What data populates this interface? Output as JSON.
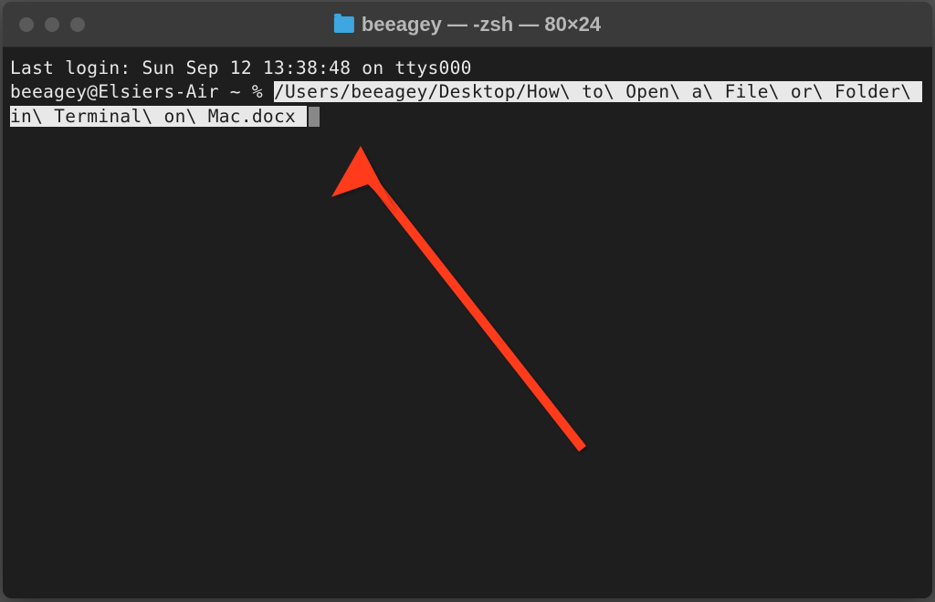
{
  "titlebar": {
    "title": "beeagey — -zsh — 80×24"
  },
  "terminal": {
    "last_login": "Last login: Sun Sep 12 13:38:48 on ttys000",
    "prompt": "beeagey@Elsiers-Air ~ % ",
    "command": "/Users/beeagey/Desktop/How\\ to\\ Open\\ a\\ File\\ or\\ Folder\\ in\\ Terminal\\ on\\ Mac.docx "
  }
}
